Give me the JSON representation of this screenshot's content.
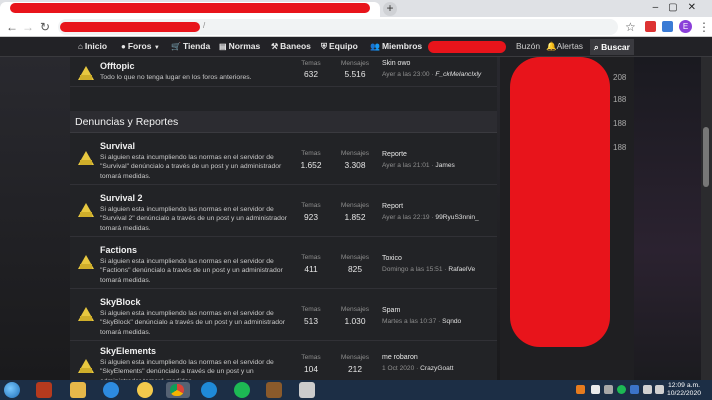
{
  "browser": {
    "url_fragment": "/",
    "avatar_letter": "E"
  },
  "nav": {
    "items": [
      {
        "icon": "⌂",
        "label": "Inicio"
      },
      {
        "icon": "●",
        "label": "Foros"
      },
      {
        "icon": "🛒",
        "label": "Tienda"
      },
      {
        "icon": "▤",
        "label": "Normas"
      },
      {
        "icon": "⚒",
        "label": "Baneos"
      },
      {
        "icon": "⛨",
        "label": "Equipo"
      },
      {
        "icon": "👥",
        "label": "Miembros"
      }
    ],
    "buzon": "Buzón",
    "alertas": "Alertas",
    "buscar": "Buscar"
  },
  "offtopic": {
    "title": "Offtopic",
    "desc": "Todo lo que no tenga lugar en los foros anteriores.",
    "temas_label": "Temas",
    "temas": "632",
    "mensajes_label": "Mensajes",
    "mensajes": "5.516",
    "last_title": "Skin owo",
    "last_time": "Ayer a las 23:00 ·",
    "last_user": "F_ckMeIancIxly"
  },
  "section": {
    "title": "Denuncias y Reportes"
  },
  "forums": [
    {
      "title": "Survival",
      "desc": "Si alguien esta incumpliendo las normas en el servidor de \"Survival\" denúncialo a través de un post y un administrador tomará medidas.",
      "temas_label": "Temas",
      "temas": "1.652",
      "mensajes_label": "Mensajes",
      "mensajes": "3.308",
      "last_title": "Reporte",
      "last_time": "Ayer a las 21:01 ·",
      "last_user": "James"
    },
    {
      "title": "Survival 2",
      "desc": "Si alguien esta incumpliendo las normas en el servidor de \"Survival 2\" denúncialo a través de un post y un administrador tomará medidas.",
      "temas_label": "Temas",
      "temas": "923",
      "mensajes_label": "Mensajes",
      "mensajes": "1.852",
      "last_title": "Report",
      "last_time": "Ayer a las 22:19 ·",
      "last_user": "99RyuS3nnin_"
    },
    {
      "title": "Factions",
      "desc": "Si alguien esta incumpliendo las normas en el servidor de \"Factions\" denúncialo a través de un post y un administrador tomará medidas.",
      "temas_label": "Temas",
      "temas": "411",
      "mensajes_label": "Mensajes",
      "mensajes": "825",
      "last_title": "Toxico",
      "last_time": "Domingo a las 15:51 ·",
      "last_user": "RafaelVe"
    },
    {
      "title": "SkyBlock",
      "desc": "Si alguien esta incumpliendo las normas en el servidor de \"SkyBlock\" denúncialo a través de un post y un administrador tomará medidas.",
      "temas_label": "Temas",
      "temas": "513",
      "mensajes_label": "Mensajes",
      "mensajes": "1.030",
      "last_title": "Spam",
      "last_time": "Martes a las 10:37 ·",
      "last_user": "Sqndo"
    },
    {
      "title": "SkyElements",
      "desc": "Si alguien esta incumpliendo las normas en el servidor de \"SkyElements\" denúncialo a través de un post y un administrador tomará medidas.",
      "temas_label": "Temas",
      "temas": "104",
      "mensajes_label": "Mensajes",
      "mensajes": "212",
      "last_title": "me robaron",
      "last_time": "1 Oct 2020 ·",
      "last_user": "CrazyGoatt"
    }
  ],
  "sidebar": {
    "counts": [
      "208",
      "188",
      "188",
      "188"
    ]
  },
  "taskbar": {
    "time": "12:09 a.m.",
    "date": "10/22/2020"
  },
  "colors": {
    "accent": "#e8141b",
    "forum_icon": "#e8c840",
    "taskbar": "#1c2e45"
  }
}
